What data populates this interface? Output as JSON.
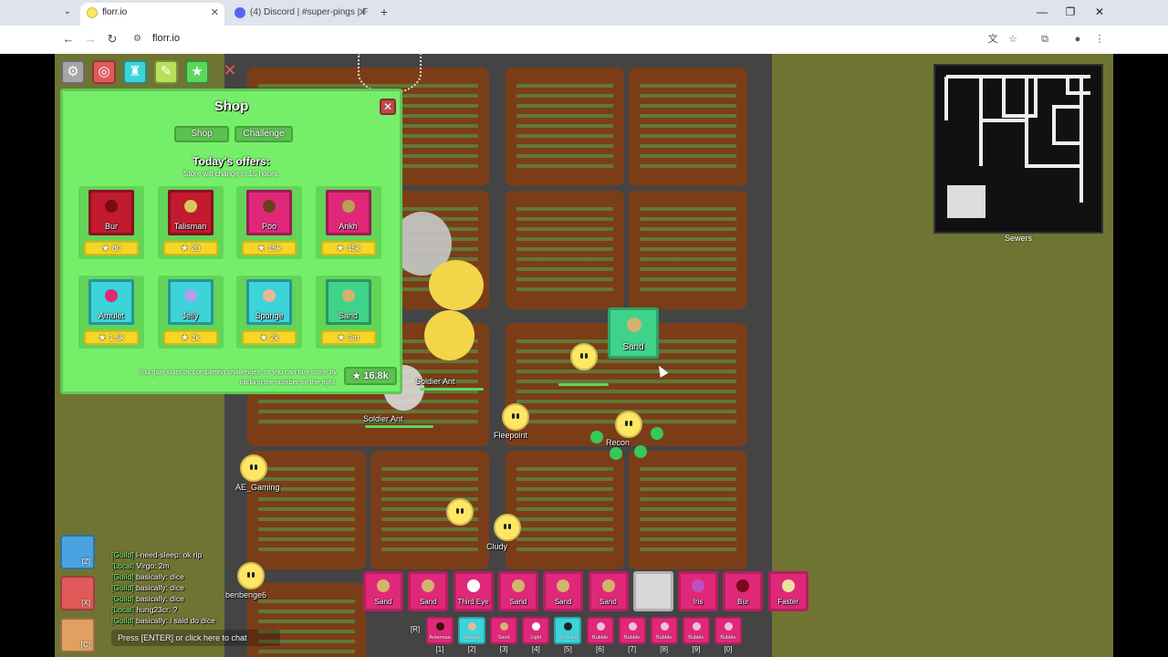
{
  "browser": {
    "tabs": [
      {
        "title": "florr.io",
        "active": true
      },
      {
        "title": "(4) Discord | #super-pings | F",
        "active": false
      }
    ],
    "url": "florr.io"
  },
  "colors": {
    "petal_common_bg": "#e0287a",
    "shop_bg": "#75ef6a",
    "price_bg": "#f6d626",
    "map_bg": "#6f7433"
  },
  "shop": {
    "title": "Shop",
    "tabs": [
      "Shop",
      "Challenge"
    ],
    "offers_title": "Today's offers:",
    "offers_sub": "Store will change in 15 hours.",
    "offers": [
      {
        "name": "Bur",
        "price": "80",
        "color": "#c21a2e",
        "icon_color": "#7a0a18"
      },
      {
        "name": "Talisman",
        "price": "20",
        "color": "#c21a2e",
        "icon_color": "#d4c95a"
      },
      {
        "name": "Poo",
        "price": "15k",
        "color": "#e0287a",
        "icon_color": "#6b3f1e"
      },
      {
        "name": "Ankh",
        "price": "45k",
        "color": "#e0287a",
        "icon_color": "#b8a050"
      },
      {
        "name": "Amulet",
        "price": "1.5k",
        "color": "#3cd4d8",
        "icon_color": "#e0287a"
      },
      {
        "name": "Jelly",
        "price": "1k",
        "color": "#3cd4d8",
        "icon_color": "#b0a0ef"
      },
      {
        "name": "Sponge",
        "price": "2k",
        "color": "#3cd4d8",
        "icon_color": "#e8b898"
      },
      {
        "name": "Sand",
        "price": "3m",
        "color": "#3fd38a",
        "icon_color": "#d3b36e"
      }
    ],
    "footer": "You gain stars by completing challenges, or you can buy some by clicking the number on the right.",
    "balance": "16.8k"
  },
  "minimap": {
    "label": "Sewers"
  },
  "drop": {
    "name": "Sand"
  },
  "players": [
    {
      "name": "Fleepoint"
    },
    {
      "name": "Recon"
    },
    {
      "name": "AE_Gaming"
    },
    {
      "name": "Cludy"
    },
    {
      "name": "benbenge6"
    }
  ],
  "mobs": [
    {
      "name": "Soldier Ant"
    },
    {
      "name": "Soldier Ant"
    }
  ],
  "hotbar": {
    "main": [
      {
        "name": "Sand",
        "color": "#e0287a",
        "icon_color": "#d3b36e"
      },
      {
        "name": "Sand",
        "color": "#e0287a",
        "icon_color": "#d3b36e"
      },
      {
        "name": "Third Eye",
        "color": "#e0287a",
        "icon_color": "#ffffff"
      },
      {
        "name": "Sand",
        "color": "#e0287a",
        "icon_color": "#d3b36e"
      },
      {
        "name": "Sand",
        "color": "#e0287a",
        "icon_color": "#d3b36e"
      },
      {
        "name": "Sand",
        "color": "#e0287a",
        "icon_color": "#d3b36e"
      },
      {
        "name": "",
        "color": "#d8d8d8",
        "icon_color": "#d8d8d8"
      },
      {
        "name": "Iris",
        "color": "#e0287a",
        "icon_color": "#c050c0"
      },
      {
        "name": "Bur",
        "color": "#e0287a",
        "icon_color": "#7a0a18"
      },
      {
        "name": "Faster",
        "color": "#e0287a",
        "icon_color": "#f0e0a0"
      }
    ],
    "secondary_key": "[R]",
    "secondary": [
      {
        "name": "Antennae",
        "key": "[1]",
        "color": "#e0287a",
        "icon_color": "#3a1010"
      },
      {
        "name": "Sponge",
        "key": "[2]",
        "color": "#3cd4d8",
        "icon_color": "#e8b898"
      },
      {
        "name": "Sand",
        "key": "[3]",
        "color": "#e0287a",
        "icon_color": "#d3b36e"
      },
      {
        "name": "Light",
        "key": "[4]",
        "color": "#e0287a",
        "icon_color": "#ffffff"
      },
      {
        "name": "Yin Yang",
        "key": "[5]",
        "color": "#3cd4d8",
        "icon_color": "#222222"
      },
      {
        "name": "Bubble",
        "key": "[6]",
        "color": "#e0287a",
        "icon_color": "#f0c0d8"
      },
      {
        "name": "Bubble",
        "key": "[7]",
        "color": "#e0287a",
        "icon_color": "#f0c0d8"
      },
      {
        "name": "Bubble",
        "key": "[8]",
        "color": "#e0287a",
        "icon_color": "#f0c0d8"
      },
      {
        "name": "Bubble",
        "key": "[9]",
        "color": "#e0287a",
        "icon_color": "#f0c0d8"
      },
      {
        "name": "Bubble",
        "key": "[0]",
        "color": "#e0287a",
        "icon_color": "#f0c0d8"
      }
    ]
  },
  "skills": [
    {
      "key": "[Z]",
      "color": "#4aa3e0"
    },
    {
      "key": "[X]",
      "color": "#e05a5a"
    },
    {
      "key": "[C]",
      "color": "#e0a060"
    }
  ],
  "chat": {
    "lines": [
      {
        "channel": "[Guild]",
        "text": "i-need-sleep: ok rip"
      },
      {
        "channel": "[Local]",
        "text": "Virgo: 2m"
      },
      {
        "channel": "[Guild]",
        "text": "basically: dice"
      },
      {
        "channel": "[Guild]",
        "text": "basically: dice"
      },
      {
        "channel": "[Guild]",
        "text": "basically: dice"
      },
      {
        "channel": "[Local]",
        "text": "hung23cr: ?"
      },
      {
        "channel": "[Guild]",
        "text": "basically: i said do dice"
      }
    ],
    "input_placeholder": "Press [ENTER] or click here to chat"
  }
}
